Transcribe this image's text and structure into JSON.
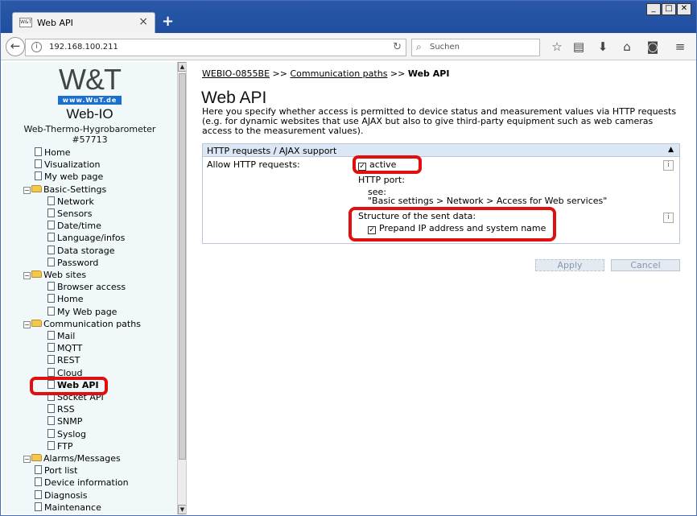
{
  "browser": {
    "tab_title": "Web API",
    "tab_favicon_text": "W&T",
    "new_tab_label": "+",
    "url": "192.168.100.211",
    "search_placeholder": "Suchen",
    "window_buttons": [
      "_",
      "□",
      "✕"
    ]
  },
  "sidebar": {
    "logo_text": "W&T",
    "logo_url": "www.WuT.de",
    "device_name": "Web-IO",
    "device_type": "Web-Thermo-Hygrobarometer",
    "device_id": "#57713",
    "tree": [
      {
        "label": "Home",
        "kind": "doc",
        "level": 0
      },
      {
        "label": "Visualization",
        "kind": "doc",
        "level": 0
      },
      {
        "label": "My web page",
        "kind": "doc",
        "level": 0
      },
      {
        "label": "Basic-Settings",
        "kind": "folder",
        "level": 0
      },
      {
        "label": "Network",
        "kind": "doc",
        "level": 1
      },
      {
        "label": "Sensors",
        "kind": "doc",
        "level": 1
      },
      {
        "label": "Date/time",
        "kind": "doc",
        "level": 1
      },
      {
        "label": "Language/infos",
        "kind": "doc",
        "level": 1
      },
      {
        "label": "Data storage",
        "kind": "doc",
        "level": 1
      },
      {
        "label": "Password",
        "kind": "doc",
        "level": 1
      },
      {
        "label": "Web sites",
        "kind": "folder",
        "level": 0
      },
      {
        "label": "Browser access",
        "kind": "doc",
        "level": 1
      },
      {
        "label": "Home",
        "kind": "doc",
        "level": 1
      },
      {
        "label": "My Web page",
        "kind": "doc",
        "level": 1
      },
      {
        "label": "Communication paths",
        "kind": "folder",
        "level": 0
      },
      {
        "label": "Mail",
        "kind": "doc",
        "level": 1
      },
      {
        "label": "MQTT",
        "kind": "doc",
        "level": 1
      },
      {
        "label": "REST",
        "kind": "doc",
        "level": 1
      },
      {
        "label": "Cloud",
        "kind": "doc",
        "level": 1
      },
      {
        "label": "Web API",
        "kind": "doc",
        "level": 1,
        "selected": true
      },
      {
        "label": "Socket API",
        "kind": "doc",
        "level": 1
      },
      {
        "label": "RSS",
        "kind": "doc",
        "level": 1
      },
      {
        "label": "SNMP",
        "kind": "doc",
        "level": 1
      },
      {
        "label": "Syslog",
        "kind": "doc",
        "level": 1
      },
      {
        "label": "FTP",
        "kind": "doc",
        "level": 1
      },
      {
        "label": "Alarms/Messages",
        "kind": "folder",
        "level": 0
      },
      {
        "label": "Port list",
        "kind": "doc",
        "level": 0
      },
      {
        "label": "Device information",
        "kind": "doc",
        "level": 0
      },
      {
        "label": "Diagnosis",
        "kind": "doc",
        "level": 0
      },
      {
        "label": "Maintenance",
        "kind": "doc",
        "level": 0
      }
    ]
  },
  "main": {
    "breadcrumb": {
      "root": "WEBIO-0855BE",
      "sep1": ">>",
      "middle": "Communication paths",
      "sep2": ">>",
      "current": "Web API"
    },
    "title": "Web API",
    "intro": "Here you specify whether access is permitted to device status and measurement values via HTTP requests (e.g. for dynamic websites that use AJAX but also to give third-party equipment such as web cameras access to the measurement values).",
    "panel": {
      "title": "HTTP requests / AJAX support",
      "collapse_glyph": "▲",
      "allow_label": "Allow HTTP requests:",
      "active_label": "active",
      "active_checked": true,
      "http_port_label": "HTTP port:",
      "see_label": "see:",
      "see_path": "\"Basic settings > Network > Access for Web services\"",
      "structure_label": "Structure of the sent data:",
      "prepend_label": "Prepand IP address and system name",
      "prepend_checked": true,
      "info_glyph": "i"
    },
    "buttons": {
      "apply": "Apply",
      "cancel": "Cancel"
    }
  }
}
